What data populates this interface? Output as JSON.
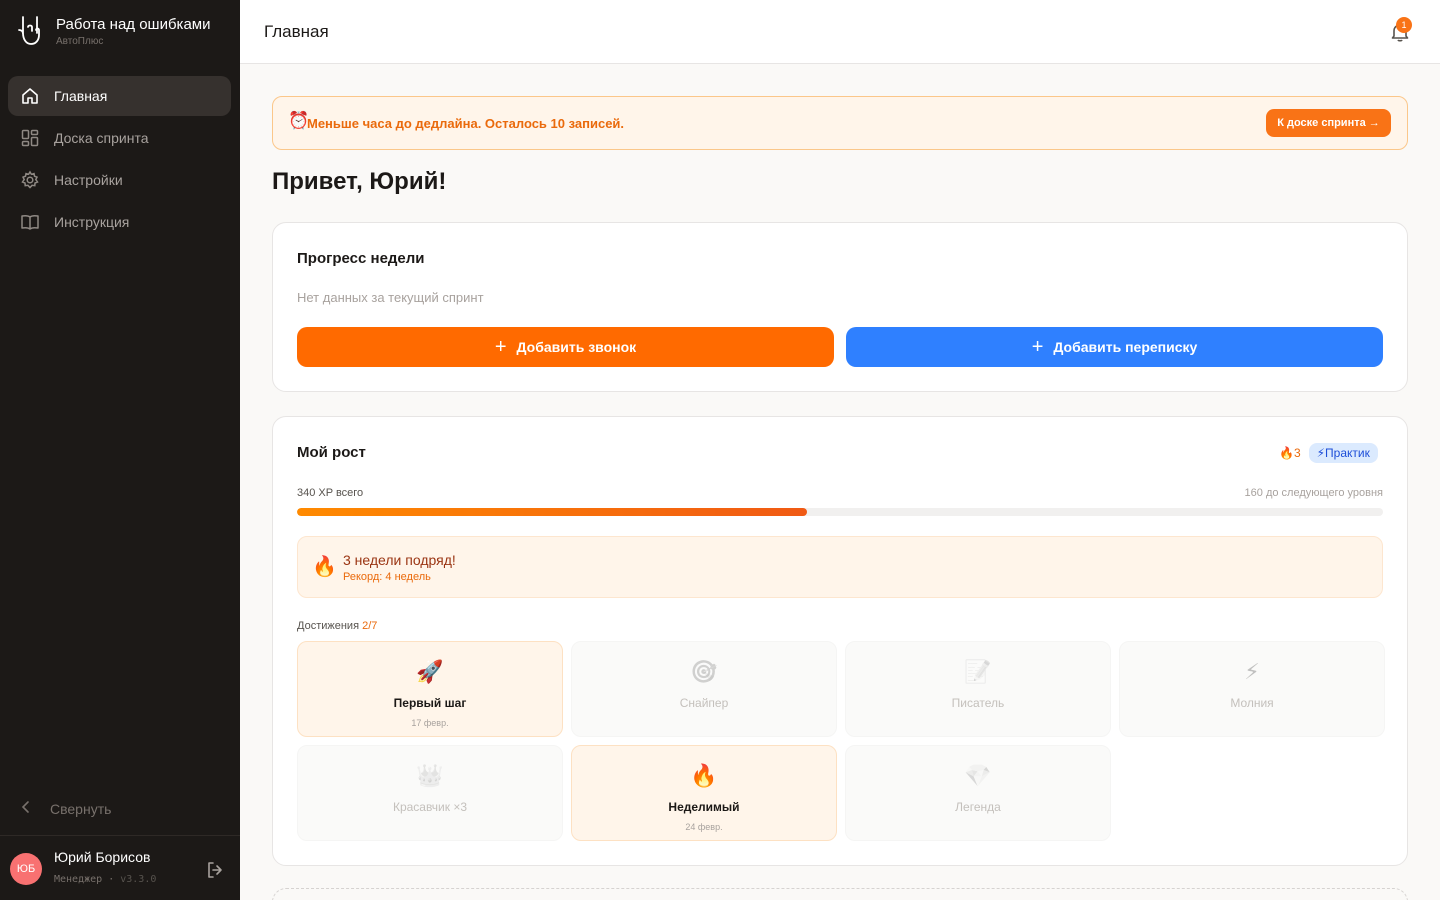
{
  "brand": {
    "title": "Работа над ошибками",
    "subtitle": "АвтоПлюс"
  },
  "sidebar": {
    "items": [
      {
        "label": "Главная",
        "icon": "home-icon",
        "active": true
      },
      {
        "label": "Доска спринта",
        "icon": "grid-icon",
        "active": false
      },
      {
        "label": "Настройки",
        "icon": "gear-icon",
        "active": false
      },
      {
        "label": "Инструкция",
        "icon": "book-icon",
        "active": false
      }
    ],
    "collapse_label": "Свернуть"
  },
  "user": {
    "initials": "ЮБ",
    "name": "Юрий Борисов",
    "role": "Менеджер",
    "version": "v3.3.0"
  },
  "header": {
    "title": "Главная",
    "notifications": "1"
  },
  "alert": {
    "icon": "⏰",
    "text": "Меньше часа до дедлайна. Осталось 10 записей.",
    "button": "К доске спринта →"
  },
  "greeting": "Привет, Юрий!",
  "progress": {
    "title": "Прогресс недели",
    "empty": "Нет данных за текущий спринт",
    "add_call": "Добавить звонок",
    "add_chat": "Добавить переписку"
  },
  "growth": {
    "title": "Мой рост",
    "streak_badge": "🔥3",
    "level_badge": "⚡Практик",
    "xp_total": "340 XP всего",
    "xp_next": "160 до следующего уровня",
    "xp_fraction": 0.47,
    "streak_icon": "🔥",
    "streak_title": "3 недели подряд!",
    "streak_record": "Рекорд: 4 недель",
    "achievements_label": "Достижения",
    "achievements_count": "2/7",
    "achievements": [
      {
        "icon": "🚀",
        "name": "Первый шаг",
        "date": "17 февр.",
        "unlocked": true,
        "semantic": "rocket-icon"
      },
      {
        "icon": "🎯",
        "name": "Снайпер",
        "date": "",
        "unlocked": false,
        "semantic": "target-icon"
      },
      {
        "icon": "📝",
        "name": "Писатель",
        "date": "",
        "unlocked": false,
        "semantic": "memo-icon"
      },
      {
        "icon": "⚡",
        "name": "Молния",
        "date": "",
        "unlocked": false,
        "semantic": "lightning-icon"
      },
      {
        "icon": "👑",
        "name": "Красавчик ×3",
        "date": "",
        "unlocked": false,
        "semantic": "crown-icon"
      },
      {
        "icon": "🔥",
        "name": "Неделимый",
        "date": "24 февр.",
        "unlocked": true,
        "semantic": "fire-icon"
      },
      {
        "icon": "💎",
        "name": "Легенда",
        "date": "",
        "unlocked": false,
        "semantic": "gem-icon"
      }
    ]
  },
  "colors": {
    "accent": "#ff6a00",
    "blue": "#2f80ff",
    "sidebar": "#1c1917"
  }
}
